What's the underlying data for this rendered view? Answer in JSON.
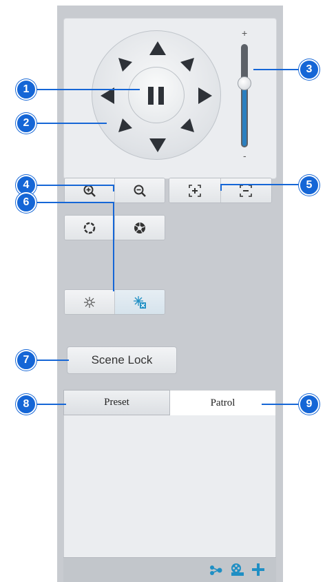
{
  "callouts": [
    "1",
    "2",
    "3",
    "4",
    "5",
    "6",
    "7",
    "8",
    "9"
  ],
  "zoom_slider": {
    "plus_label": "+",
    "minus_label": "-"
  },
  "scene_lock": {
    "label": "Scene Lock"
  },
  "tabs": [
    {
      "label": "Preset",
      "selected": false
    },
    {
      "label": "Patrol",
      "selected": true
    }
  ],
  "footer_icons": [
    "path-icon",
    "camera-reel-icon",
    "add-icon"
  ],
  "colors": {
    "callout": "#1566d6",
    "icon_blue": "#1f8fc4",
    "slider_fill": "#2a7fc0"
  }
}
